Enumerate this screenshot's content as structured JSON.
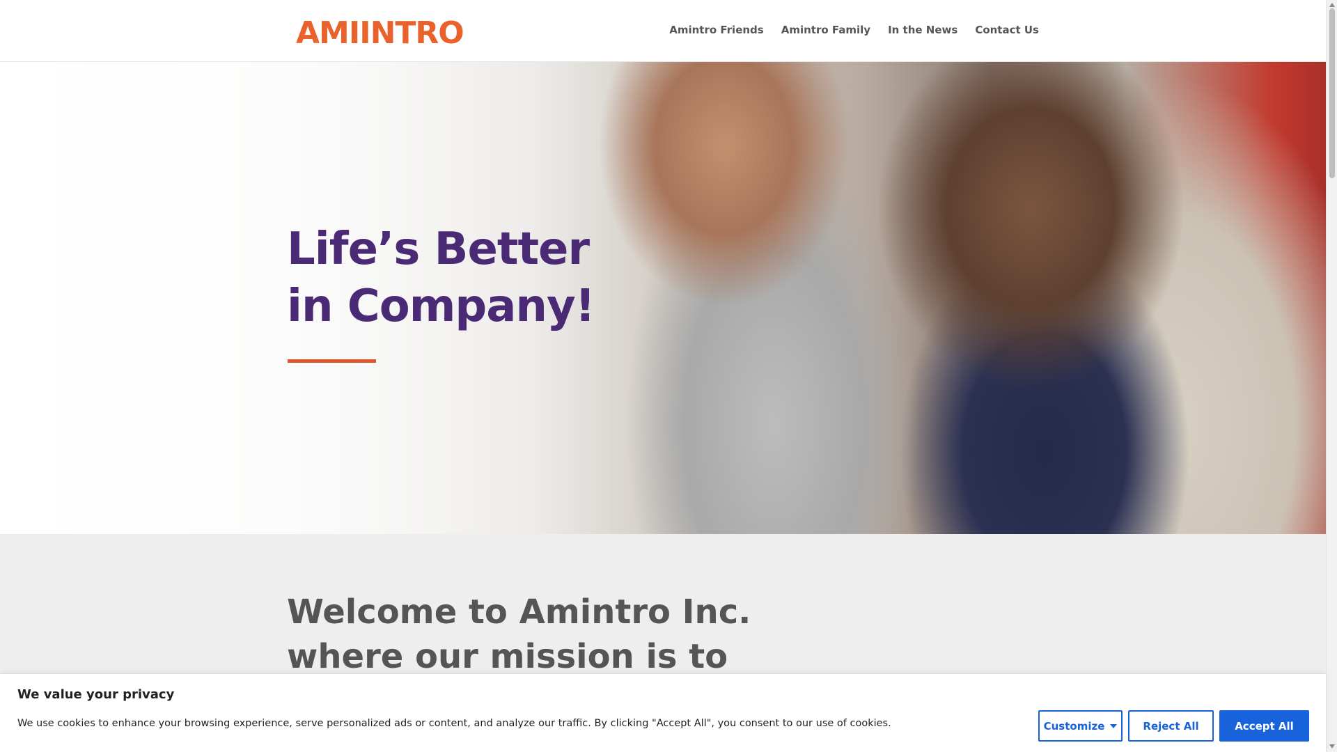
{
  "header": {
    "logo_text": "AMIINTRO",
    "nav": [
      {
        "label": "Amintro Friends"
      },
      {
        "label": "Amintro Family"
      },
      {
        "label": "In the News"
      },
      {
        "label": "Contact Us"
      }
    ]
  },
  "hero": {
    "title_line1": "Life’s Better",
    "title_line2": "in Company!"
  },
  "welcome": {
    "title": "Welcome to Amintro Inc. where our mission is to improve your life"
  },
  "cookie_banner": {
    "title": "We value your privacy",
    "text": "We use cookies to enhance your browsing experience, serve personalized ads or content, and analyze our traffic. By clicking \"Accept All\", you consent to our use of cookies.",
    "customize_label": "Customize",
    "reject_label": "Reject All",
    "accept_label": "Accept All"
  },
  "colors": {
    "brand_orange": "#e8622c",
    "brand_purple": "#4b2a75",
    "button_blue": "#1863dc"
  }
}
